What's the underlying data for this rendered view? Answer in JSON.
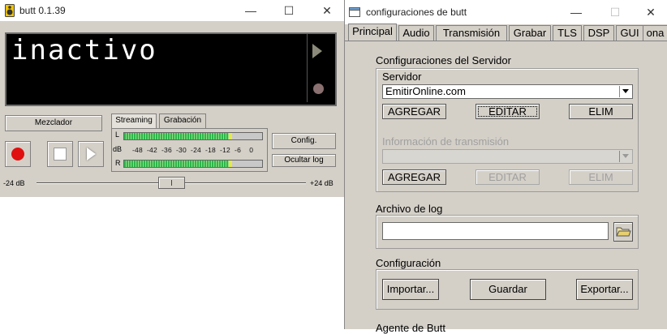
{
  "butt": {
    "title": "butt 0.1.39",
    "window_controls": {
      "minimize": "—",
      "maximize": "☐",
      "close": "✕"
    },
    "display_status": "inactivo",
    "mixer_label": "Mezclador",
    "tabs": [
      "Streaming",
      "Grabación"
    ],
    "meter": {
      "left_label": "L",
      "right_label": "R",
      "db_label": "dB",
      "scale": "-48  -42  -36  -30  -24  -18  -12  -6    0",
      "left_level": 0.77,
      "right_level": 0.77
    },
    "config_label": "Config.",
    "hide_log_label": "Ocultar log",
    "slider": {
      "min_label": "-24 dB",
      "max_label": "+24 dB",
      "value_fraction": 0.5
    }
  },
  "config": {
    "title": "configuraciones de butt",
    "window_controls": {
      "minimize": "—",
      "maximize": "☐",
      "close": "✕"
    },
    "tabs": [
      "Principal",
      "Audio",
      "Transmisión",
      "Grabar",
      "TLS",
      "DSP",
      "GUI",
      "ona"
    ],
    "server_section": "Configuraciones del Servidor",
    "server_group": "Servidor",
    "server_value": "EmitirOnline.com",
    "server_buttons": [
      "AGREGAR",
      "EDITAR",
      "ELIM"
    ],
    "stream_info_label": "Información de transmisión",
    "stream_info_value": "",
    "stream_info_buttons": [
      "AGREGAR",
      "EDITAR",
      "ELIM"
    ],
    "log_section": "Archivo de log",
    "log_value": "",
    "configuration_section": "Configuración",
    "configuration_buttons": [
      "Importar...",
      "Guardar",
      "Exportar..."
    ],
    "agent_section": "Agente de Butt"
  }
}
